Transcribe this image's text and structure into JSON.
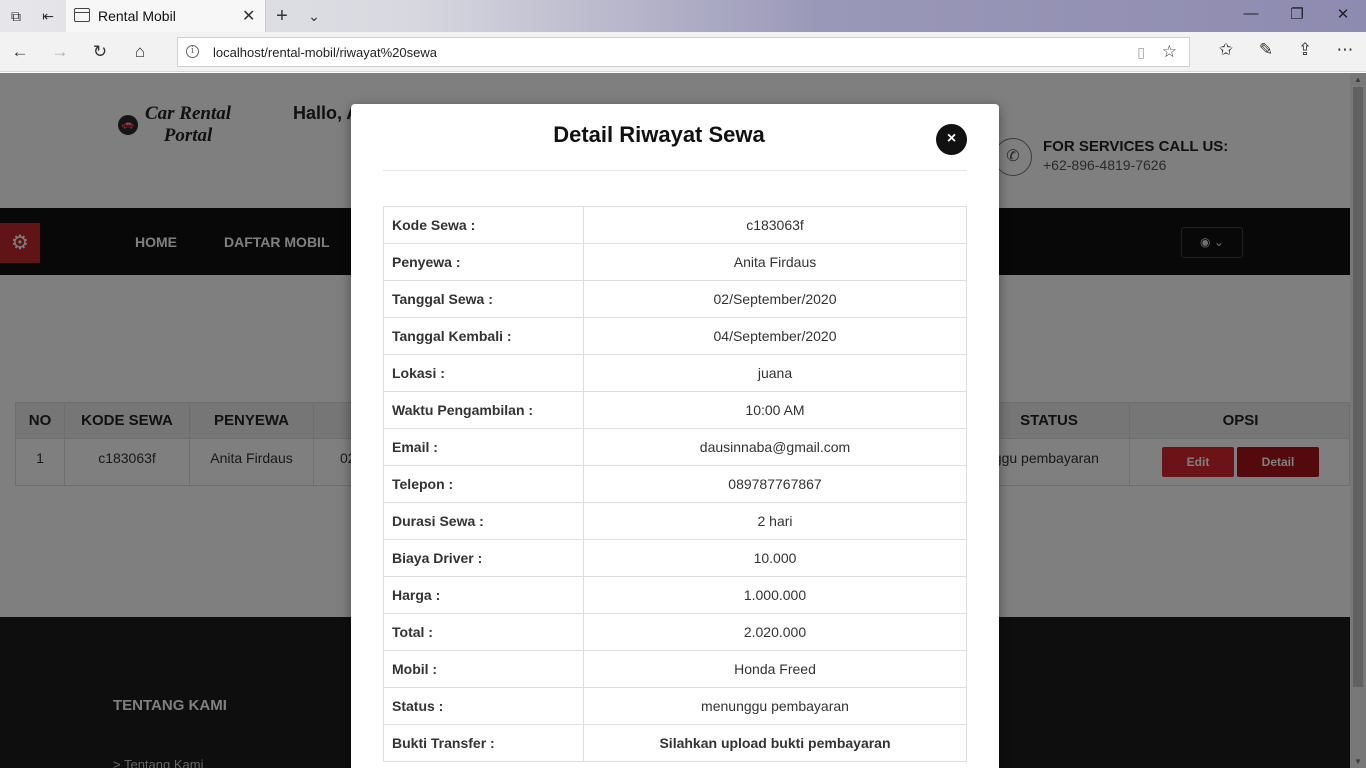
{
  "browser": {
    "tab_title": "Rental Mobil",
    "url": "localhost/rental-mobil/riwayat%20sewa"
  },
  "site": {
    "logo_line1": "Car Rental",
    "logo_line2": "Portal",
    "greeting": "Hallo, A",
    "call_label": "FOR SERVICES CALL US:",
    "call_number": "+62-896-4819-7626",
    "nav": [
      "HOME",
      "DAFTAR MOBIL"
    ]
  },
  "rental_table": {
    "headers": [
      "NO",
      "KODE SEWA",
      "PENYEWA",
      "STATUS",
      "OPSI"
    ],
    "row": {
      "no": "1",
      "kode": "c183063f",
      "penyewa": "Anita Firdaus",
      "tanggal_partial": "02",
      "status_partial": "nggu pembayaran",
      "edit_label": "Edit",
      "detail_label": "Detail"
    }
  },
  "footer": {
    "title": "TENTANG KAMI",
    "link": "> Tentang Kami"
  },
  "modal": {
    "title": "Detail Riwayat Sewa",
    "close_label": "×",
    "rows": [
      {
        "label": "Kode Sewa :",
        "value": "c183063f"
      },
      {
        "label": "Penyewa :",
        "value": "Anita Firdaus"
      },
      {
        "label": "Tanggal Sewa :",
        "value": "02/September/2020"
      },
      {
        "label": "Tanggal Kembali :",
        "value": "04/September/2020"
      },
      {
        "label": "Lokasi :",
        "value": "juana"
      },
      {
        "label": "Waktu Pengambilan :",
        "value": "10:00 AM"
      },
      {
        "label": "Email :",
        "value": "dausinnaba@gmail.com"
      },
      {
        "label": "Telepon :",
        "value": "089787767867"
      },
      {
        "label": "Durasi Sewa :",
        "value": "2 hari"
      },
      {
        "label": "Biaya Driver :",
        "value": "10.000"
      },
      {
        "label": "Harga :",
        "value": "1.000.000"
      },
      {
        "label": "Total :",
        "value": "2.020.000"
      },
      {
        "label": "Mobil :",
        "value": "Honda Freed"
      },
      {
        "label": "Status :",
        "value": "menunggu pembayaran"
      },
      {
        "label": "Bukti Transfer :",
        "value": "Silahkan upload bukti pembayaran"
      }
    ]
  }
}
